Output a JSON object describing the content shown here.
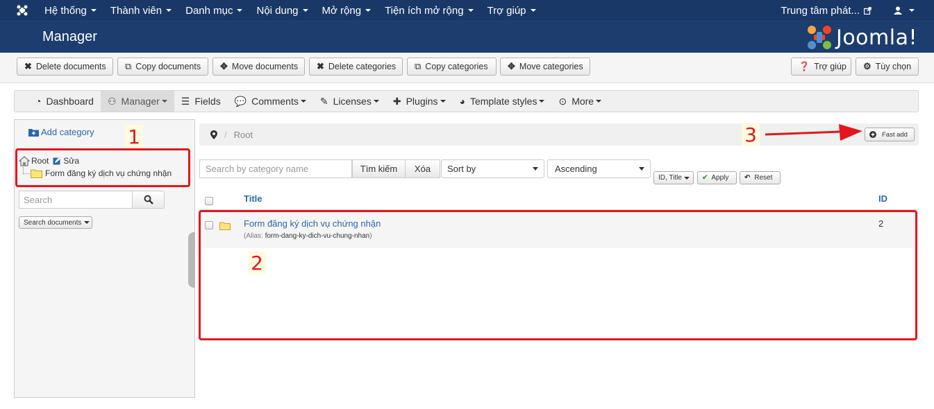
{
  "topnav": {
    "menu": [
      "Hệ thống",
      "Thành viên",
      "Danh mục",
      "Nội dung",
      "Mở rộng",
      "Tiện ích mở rộng",
      "Trợ giúp"
    ],
    "site_link": "Trung tâm phát...",
    "user_icon": "user-icon"
  },
  "header": {
    "title": "Manager",
    "brand": "Joomla!"
  },
  "toolbar": {
    "delete_documents": "Delete documents",
    "copy_documents": "Copy documents",
    "move_documents": "Move documents",
    "delete_categories": "Delete categories",
    "copy_categories": "Copy categories",
    "move_categories": "Move categories",
    "help": "Trợ giúp",
    "options": "Tùy chọn"
  },
  "subnav": [
    "Dashboard",
    "Manager",
    "Fields",
    "Comments",
    "Licenses",
    "Plugins",
    "Template styles",
    "More"
  ],
  "sidebar": {
    "add_category": "Add category",
    "tree_root": "Root",
    "tree_edit": "Sửa",
    "tree_child": "Form đăng ký dịch vụ chứng nhận",
    "search_placeholder": "Search",
    "search_documents": "Search documents"
  },
  "breadcrumb": {
    "root": "Root",
    "fast_add": "Fast add"
  },
  "filters": {
    "search_placeholder": "Search by category name",
    "search_button": "Tìm kiếm",
    "clear_button": "Xóa",
    "sort_by": "Sort by",
    "order": "Ascending",
    "columns": "ID, Title",
    "apply": "Apply",
    "reset": "Reset"
  },
  "table": {
    "headers": {
      "title": "Title",
      "id": "ID"
    },
    "rows": [
      {
        "title": "Form đăng ký dịch vụ chứng nhận",
        "alias_label": "(Alias:",
        "alias": "form-dang-ky-dich-vu-chung-nhan",
        "alias_end": ")",
        "id": "2"
      }
    ]
  },
  "annotations": {
    "n1": "1",
    "n2": "2",
    "n3": "3"
  },
  "colors": {
    "nav": "#1a3867",
    "header": "#1c3d6e",
    "link": "#2a67a8",
    "annotation": "#e4161c"
  }
}
